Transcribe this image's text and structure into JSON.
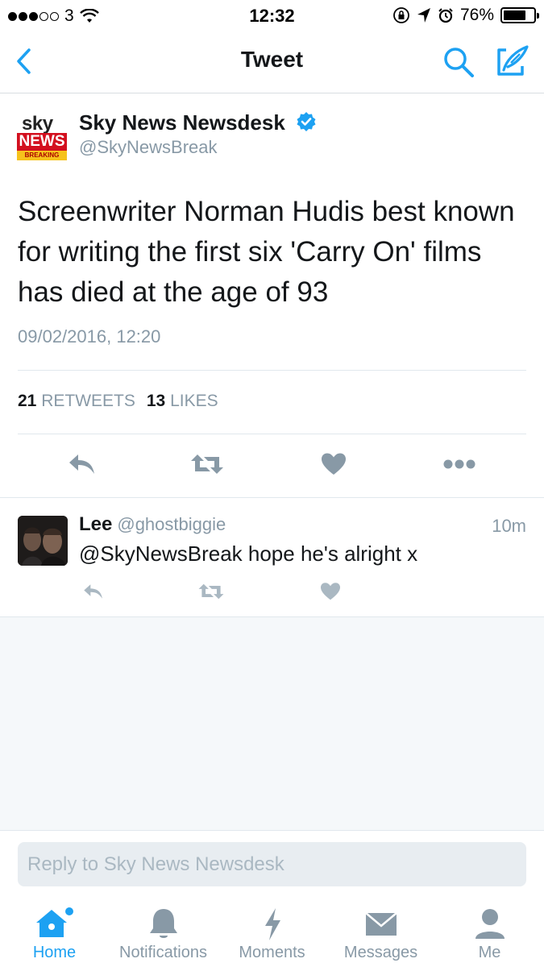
{
  "status_bar": {
    "carrier": "3",
    "time": "12:32",
    "battery": "76%",
    "battery_level": 0.76
  },
  "nav": {
    "title": "Tweet",
    "back_icon": "chevron-left-icon",
    "search_icon": "search-icon",
    "compose_icon": "compose-icon"
  },
  "tweet": {
    "logo": {
      "sky": "sky",
      "news": "NEWS",
      "breaking": "BREAKING"
    },
    "author_name": "Sky News Newsdesk",
    "author_handle": "@SkyNewsBreak",
    "text": "Screenwriter Norman Hudis best known for writing the first six 'Carry On' films has died at the age of 93",
    "timestamp": "09/02/2016, 12:20",
    "retweets_count": "21",
    "retweets_label": "RETWEETS",
    "likes_count": "13",
    "likes_label": "LIKES"
  },
  "reply": {
    "name": "Lee",
    "handle": "@ghostbiggie",
    "time": "10m",
    "text": "@SkyNewsBreak hope he's alright x"
  },
  "reply_box": {
    "placeholder": "Reply to Sky News Newsdesk"
  },
  "tabs": [
    {
      "label": "Home",
      "icon": "home-icon",
      "active": true
    },
    {
      "label": "Notifications",
      "icon": "bell-icon",
      "active": false
    },
    {
      "label": "Moments",
      "icon": "lightning-icon",
      "active": false
    },
    {
      "label": "Messages",
      "icon": "envelope-icon",
      "active": false
    },
    {
      "label": "Me",
      "icon": "person-icon",
      "active": false
    }
  ],
  "colors": {
    "accent": "#1da1f2",
    "icon_grey": "#8899a6",
    "text": "#14171a",
    "sky_red": "#d3101f"
  }
}
